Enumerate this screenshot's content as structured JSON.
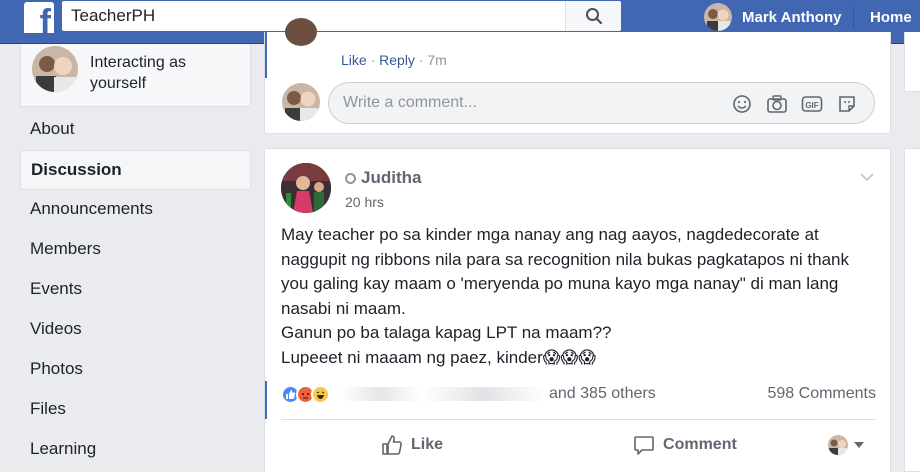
{
  "header": {
    "logo_letter": "f",
    "search_value": "TeacherPH",
    "user_name": "Mark Anthony",
    "home_label": "Home",
    "brand_color": "#4267b2"
  },
  "sidebar": {
    "acting_as": "Interacting as yourself",
    "items": [
      {
        "label": "About",
        "active": false
      },
      {
        "label": "Discussion",
        "active": true
      },
      {
        "label": "Announcements",
        "active": false
      },
      {
        "label": "Members",
        "active": false
      },
      {
        "label": "Events",
        "active": false
      },
      {
        "label": "Videos",
        "active": false
      },
      {
        "label": "Photos",
        "active": false
      },
      {
        "label": "Files",
        "active": false
      },
      {
        "label": "Learning",
        "active": false
      }
    ]
  },
  "previous_comment": {
    "like": "Like",
    "reply": "Reply",
    "time": "7m",
    "comment_placeholder": "Write a comment...",
    "icons": [
      "smiley-icon",
      "camera-icon",
      "gif-icon",
      "sticker-icon"
    ]
  },
  "post": {
    "author": "Juditha",
    "time": "20 hrs",
    "lines": [
      "May teacher po sa kinder mga nanay ang nag aayos, nagdedecorate at naggupit ng ribbons nila para sa recognition nila bukas pagkatapos ni thank you galing kay maam o 'meryenda po muna kayo mga nanay\" di man lang nasabi ni maam.",
      "Ganun po ba talaga kapag LPT na maam??",
      "Lupeeet ni maaam ng paez, kinder😱😱😱"
    ],
    "reaction_icons": [
      "like-reaction-icon",
      "angry-reaction-icon",
      "haha-reaction-icon"
    ],
    "reactions_text": "and 385 others",
    "comments_count": "598 Comments",
    "like_label": "Like",
    "comment_label": "Comment"
  }
}
